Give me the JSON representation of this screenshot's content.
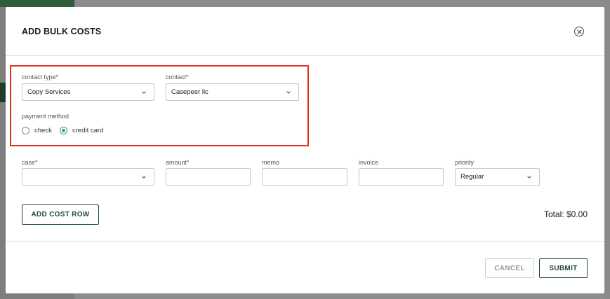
{
  "modal": {
    "title": "ADD BULK COSTS",
    "close_icon": "close-circle-icon"
  },
  "contact_section": {
    "contact_type": {
      "label": "contact type*",
      "value": "Copy Services"
    },
    "contact": {
      "label": "contact*",
      "value": "Casepeer llc"
    },
    "payment_method": {
      "label": "payment method",
      "options": [
        {
          "label": "check",
          "selected": false
        },
        {
          "label": "credit card",
          "selected": true
        }
      ]
    }
  },
  "cost_row": {
    "case": {
      "label": "case*",
      "value": ""
    },
    "amount": {
      "label": "amount*",
      "value": ""
    },
    "memo": {
      "label": "memo",
      "value": ""
    },
    "invoice": {
      "label": "invoice",
      "value": ""
    },
    "priority": {
      "label": "priority",
      "value": "Regular"
    }
  },
  "actions": {
    "add_cost_row": "ADD COST ROW",
    "total": "Total: $0.00",
    "cancel": "CANCEL",
    "submit": "SUBMIT"
  },
  "colors": {
    "accent": "#1e4d3c",
    "radio_selected": "#3aa56a",
    "highlight": "#e0301e"
  }
}
